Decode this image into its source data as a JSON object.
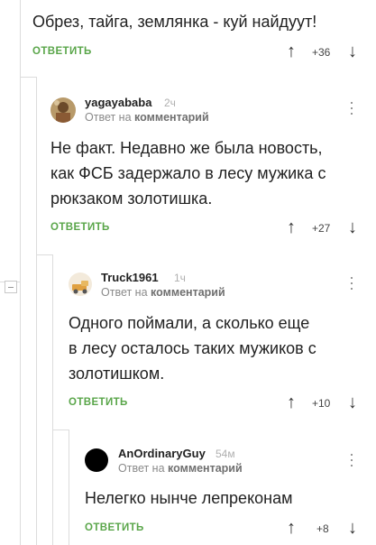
{
  "comments": [
    {
      "text": "Обрез, тайга, землянка - куй найдуут!",
      "reply_label": "ОТВЕТИТЬ",
      "votes": "+36"
    },
    {
      "author": "yagayababa",
      "time": "2ч",
      "meta_prefix": "Ответ на",
      "meta_target": "комментарий",
      "text_lines": [
        "Не факт. Недавно же была новость,",
        "как ФСБ задержало в лесу мужика с",
        "рюкзаком золотишка."
      ],
      "reply_label": "ОТВЕТИТЬ",
      "votes": "+27"
    },
    {
      "author": "Truck1961",
      "time": "1ч",
      "meta_prefix": "Ответ на",
      "meta_target": "комментарий",
      "text_lines": [
        "Одного поймали, а сколько еще",
        "в лесу осталось таких мужиков с",
        "золотишком."
      ],
      "reply_label": "ОТВЕТИТЬ",
      "votes": "+10"
    },
    {
      "author": "AnOrdinaryGuy",
      "time": "54м",
      "meta_prefix": "Ответ на",
      "meta_target": "комментарий",
      "text_lines": [
        "Нелегко нынче лепреконам"
      ],
      "reply_label": "ОТВЕТИТЬ",
      "votes": "+8"
    }
  ],
  "icons": {
    "upvote": "arrow-up-icon",
    "downvote": "arrow-down-icon",
    "menu": "more-vertical-icon",
    "collapse": "collapse-minus-icon"
  },
  "colors": {
    "reply_green": "#5aa64a",
    "thread_line": "#dcdcdc",
    "meta_gray": "#8a8a8a"
  }
}
